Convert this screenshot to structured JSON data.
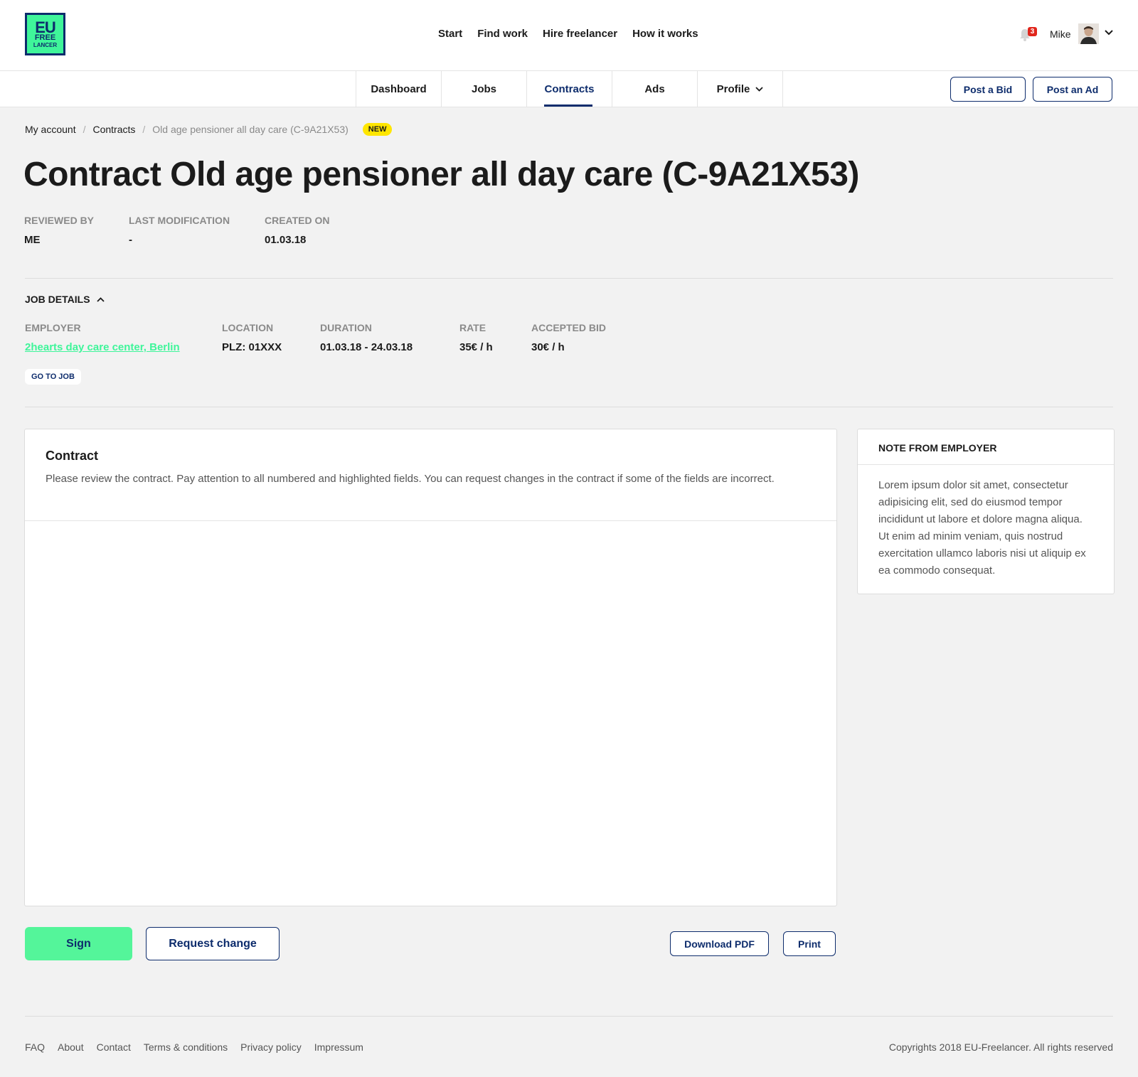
{
  "logo": {
    "line1": "EU",
    "line2": "FREE",
    "line3": "LANCER"
  },
  "main_nav": [
    "Start",
    "Find work",
    "Hire freelancer",
    "How it works"
  ],
  "user": {
    "name": "Mike",
    "notifications": "3"
  },
  "tabs": [
    {
      "label": "Dashboard"
    },
    {
      "label": "Jobs"
    },
    {
      "label": "Contracts"
    },
    {
      "label": "Ads"
    },
    {
      "label": "Profile"
    }
  ],
  "actions": {
    "post_bid": "Post a Bid",
    "post_ad": "Post an Ad"
  },
  "breadcrumb": {
    "items": [
      "My account",
      "Contracts"
    ],
    "current": "Old age pensioner all day care (C-9A21X53)",
    "badge": "NEW"
  },
  "title": "Contract Old age pensioner all day care (C-9A21X53)",
  "meta": {
    "reviewed_by": {
      "label": "REVIEWED BY",
      "value": "ME"
    },
    "last_modification": {
      "label": "LAST MODIFICATION",
      "value": "-"
    },
    "created_on": {
      "label": "CREATED ON",
      "value": "01.03.18"
    }
  },
  "job_details": {
    "toggle_label": "JOB DETAILS",
    "employer": {
      "label": "EMPLOYER",
      "value": "2hearts day care center, Berlin"
    },
    "location": {
      "label": "LOCATION",
      "value": "PLZ: 01XXX"
    },
    "duration": {
      "label": "DURATION",
      "value": "01.03.18 - 24.03.18"
    },
    "rate": {
      "label": "RATE",
      "value": "35€ / h"
    },
    "accepted_bid": {
      "label": "ACCEPTED BID",
      "value": "30€ / h"
    },
    "go_to_job": "GO TO JOB"
  },
  "contract": {
    "title": "Contract",
    "description": "Please review the contract. Pay attention to all numbered and highlighted fields. You can request changes in the contract if some of the fields are incorrect."
  },
  "note": {
    "title": "NOTE FROM EMPLOYER",
    "body": "Lorem ipsum dolor sit amet, consectetur adipisicing elit, sed do eiusmod tempor incididunt ut labore et dolore magna aliqua. Ut enim ad minim veniam, quis nostrud exercitation ullamco laboris nisi ut aliquip ex ea commodo consequat."
  },
  "buttons": {
    "sign": "Sign",
    "request_change": "Request change",
    "download_pdf": "Download PDF",
    "print": "Print"
  },
  "footer": {
    "links": [
      "FAQ",
      "About",
      "Contact",
      "Terms & conditions",
      "Privacy policy",
      "Impressum"
    ],
    "copyright": "Copyrights 2018 EU-Freelancer. All rights reserved"
  },
  "colors": {
    "brand_navy": "#0d2c6c",
    "brand_green": "#3ff59a",
    "badge_yellow": "#ffe600",
    "notification_red": "#e1261c"
  }
}
